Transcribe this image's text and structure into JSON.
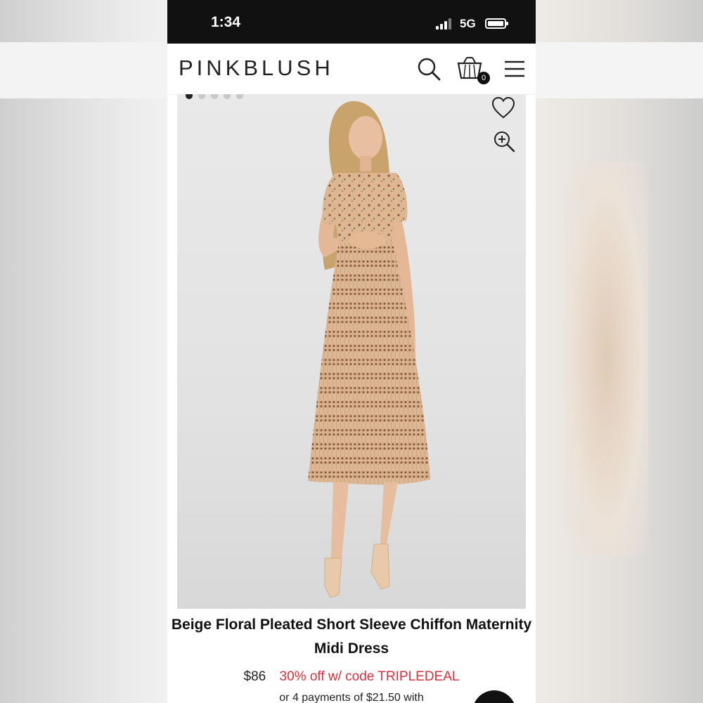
{
  "status_bar": {
    "time": "1:34",
    "network": "5G"
  },
  "header": {
    "logo": "PINKBLUSH",
    "cart_count": "0",
    "icons": [
      "search-icon",
      "shopping-bag-icon",
      "hamburger-menu-icon"
    ]
  },
  "gallery": {
    "image_count": 5,
    "active_index": 0,
    "icons": [
      "heart-icon",
      "zoom-in-icon"
    ]
  },
  "product": {
    "title": "Beige Floral Pleated Short Sleeve Chiffon Maternity Midi Dress",
    "price": "$86",
    "promo": "30% off w/ code TRIPLEDEAL",
    "installments": "or 4 payments of $21.50 with"
  },
  "colors": {
    "brand_text": "#222222",
    "promo_red": "#d6323d",
    "status_bar": "#111111",
    "dress_beige": "#d9b48e"
  }
}
